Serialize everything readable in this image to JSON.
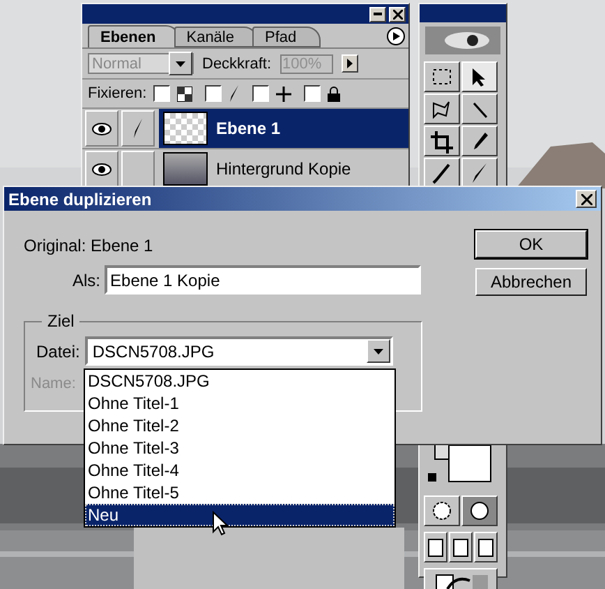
{
  "layers_panel": {
    "tabs": [
      {
        "label": "Ebenen",
        "selected": true
      },
      {
        "label": "Kanäle",
        "selected": false
      },
      {
        "label": "Pfad",
        "selected": false
      }
    ],
    "blend_mode": {
      "value": "Normal",
      "disabled": true
    },
    "opacity": {
      "label": "Deckkraft:",
      "value": "100%",
      "disabled": true
    },
    "lock": {
      "label": "Fixieren:",
      "options": [
        {
          "kind": "transparency",
          "checked": false
        },
        {
          "kind": "brush",
          "checked": false
        },
        {
          "kind": "move",
          "checked": false
        },
        {
          "kind": "all",
          "checked": false
        }
      ]
    },
    "layers": [
      {
        "name": "Ebene 1",
        "selected": true,
        "visible": true,
        "brush": true
      },
      {
        "name": "Hintergrund Kopie",
        "selected": false,
        "visible": true,
        "brush": false
      }
    ]
  },
  "dialog": {
    "title": "Ebene duplizieren",
    "original": "Original: Ebene 1",
    "as_label": "Als:",
    "as_value": "Ebene 1 Kopie",
    "buttons": [
      "OK",
      "Abbrechen"
    ],
    "group": "Ziel",
    "file_label": "Datei:",
    "file_value": "DSCN5708.JPG",
    "name_label": {
      "text": "Name:",
      "disabled": true
    },
    "file_options": [
      {
        "label": "DSCN5708.JPG",
        "selected": false
      },
      {
        "label": "Ohne Titel-1",
        "selected": false
      },
      {
        "label": "Ohne Titel-2",
        "selected": false
      },
      {
        "label": "Ohne Titel-3",
        "selected": false
      },
      {
        "label": "Ohne Titel-4",
        "selected": false
      },
      {
        "label": "Ohne Titel-5",
        "selected": false
      },
      {
        "label": "Neu",
        "selected": true
      }
    ]
  }
}
